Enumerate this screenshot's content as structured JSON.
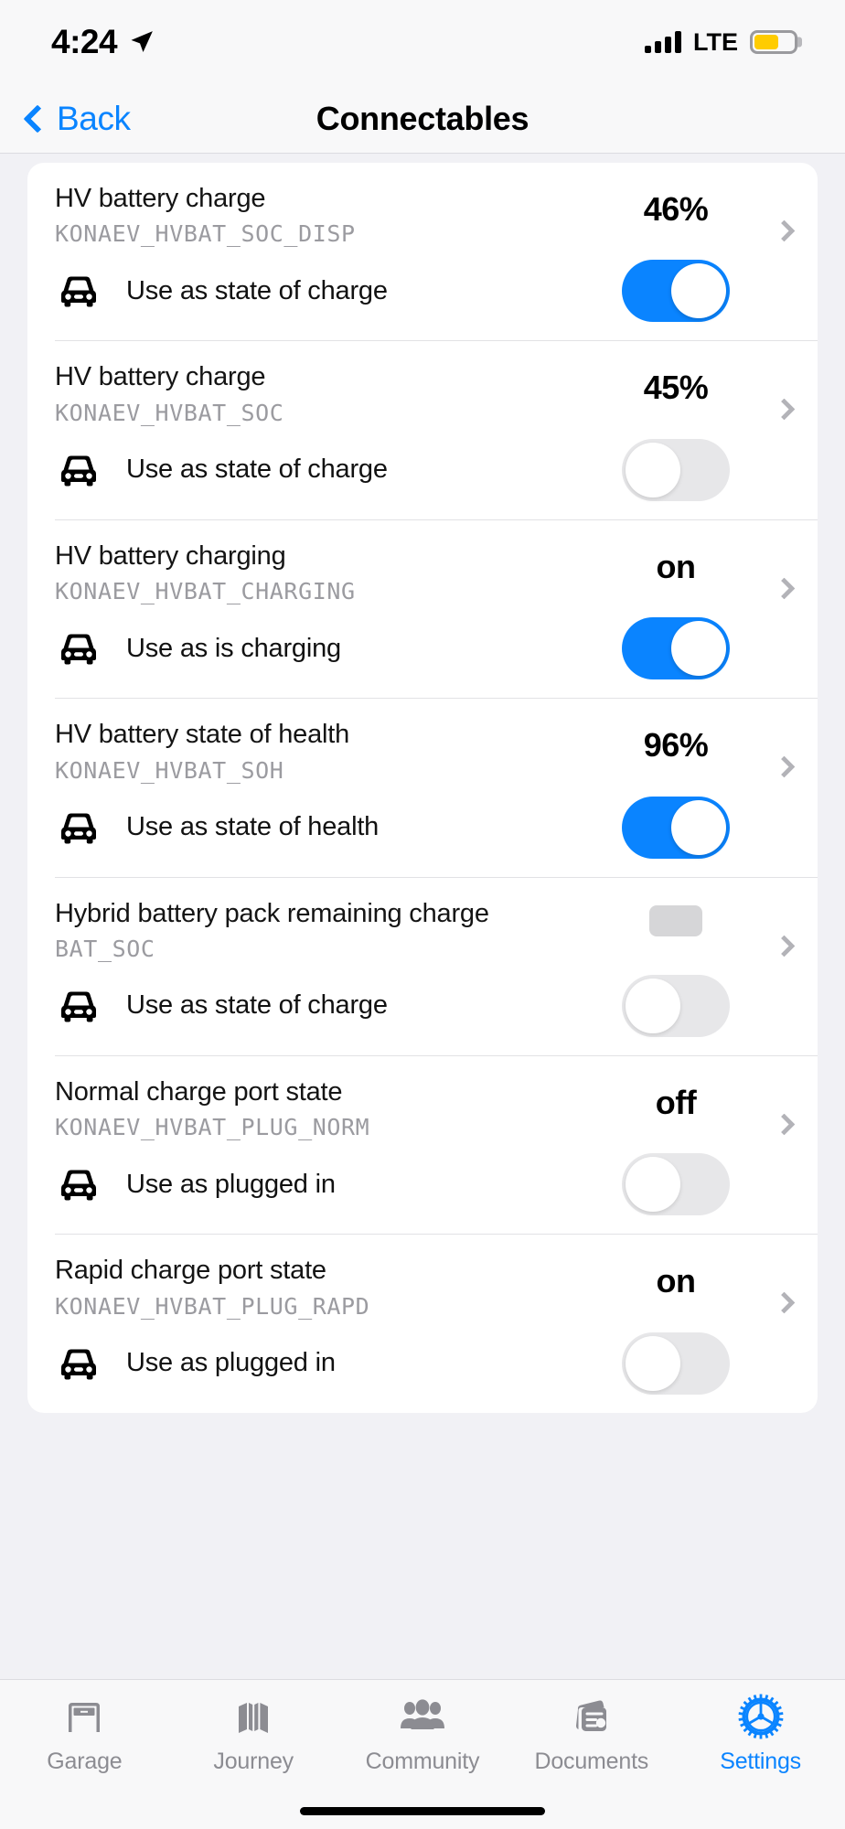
{
  "status_bar": {
    "time": "4:24",
    "location_icon": "location-arrow-icon",
    "network": "LTE",
    "battery_level_pct": 62,
    "battery_color": "#FFCC00"
  },
  "nav": {
    "back_label": "Back",
    "title": "Connectables",
    "accent_color": "#0a84ff"
  },
  "list": {
    "items": [
      {
        "name": "HV battery charge",
        "code": "KONAEV_HVBAT_SOC_DISP",
        "value": "46%",
        "value_is_placeholder": false,
        "sub_label": "Use as state of charge",
        "toggle_state": "on"
      },
      {
        "name": "HV battery charge",
        "code": "KONAEV_HVBAT_SOC",
        "value": "45%",
        "value_is_placeholder": false,
        "sub_label": "Use as state of charge",
        "toggle_state": "off"
      },
      {
        "name": "HV battery charging",
        "code": "KONAEV_HVBAT_CHARGING",
        "value": "on",
        "value_is_placeholder": false,
        "sub_label": "Use as is charging",
        "toggle_state": "on"
      },
      {
        "name": "HV battery state of health",
        "code": "KONAEV_HVBAT_SOH",
        "value": "96%",
        "value_is_placeholder": false,
        "sub_label": "Use as state of health",
        "toggle_state": "on"
      },
      {
        "name": "Hybrid battery pack remaining charge",
        "code": "BAT_SOC",
        "value": "",
        "value_is_placeholder": true,
        "sub_label": "Use as state of charge",
        "toggle_state": "off"
      },
      {
        "name": "Normal charge port state",
        "code": "KONAEV_HVBAT_PLUG_NORM",
        "value": "off",
        "value_is_placeholder": false,
        "sub_label": "Use as plugged in",
        "toggle_state": "off"
      },
      {
        "name": "Rapid charge port state",
        "code": "KONAEV_HVBAT_PLUG_RAPD",
        "value": "on",
        "value_is_placeholder": false,
        "sub_label": "Use as plugged in",
        "toggle_state": "off"
      }
    ]
  },
  "tabbar": {
    "active_index": 4,
    "active_color": "#0a84ff",
    "inactive_color": "#8c8c92",
    "tabs": [
      {
        "label": "Garage",
        "icon": "garage-icon"
      },
      {
        "label": "Journey",
        "icon": "map-icon"
      },
      {
        "label": "Community",
        "icon": "people-icon"
      },
      {
        "label": "Documents",
        "icon": "documents-icon"
      },
      {
        "label": "Settings",
        "icon": "gear-icon"
      }
    ]
  }
}
